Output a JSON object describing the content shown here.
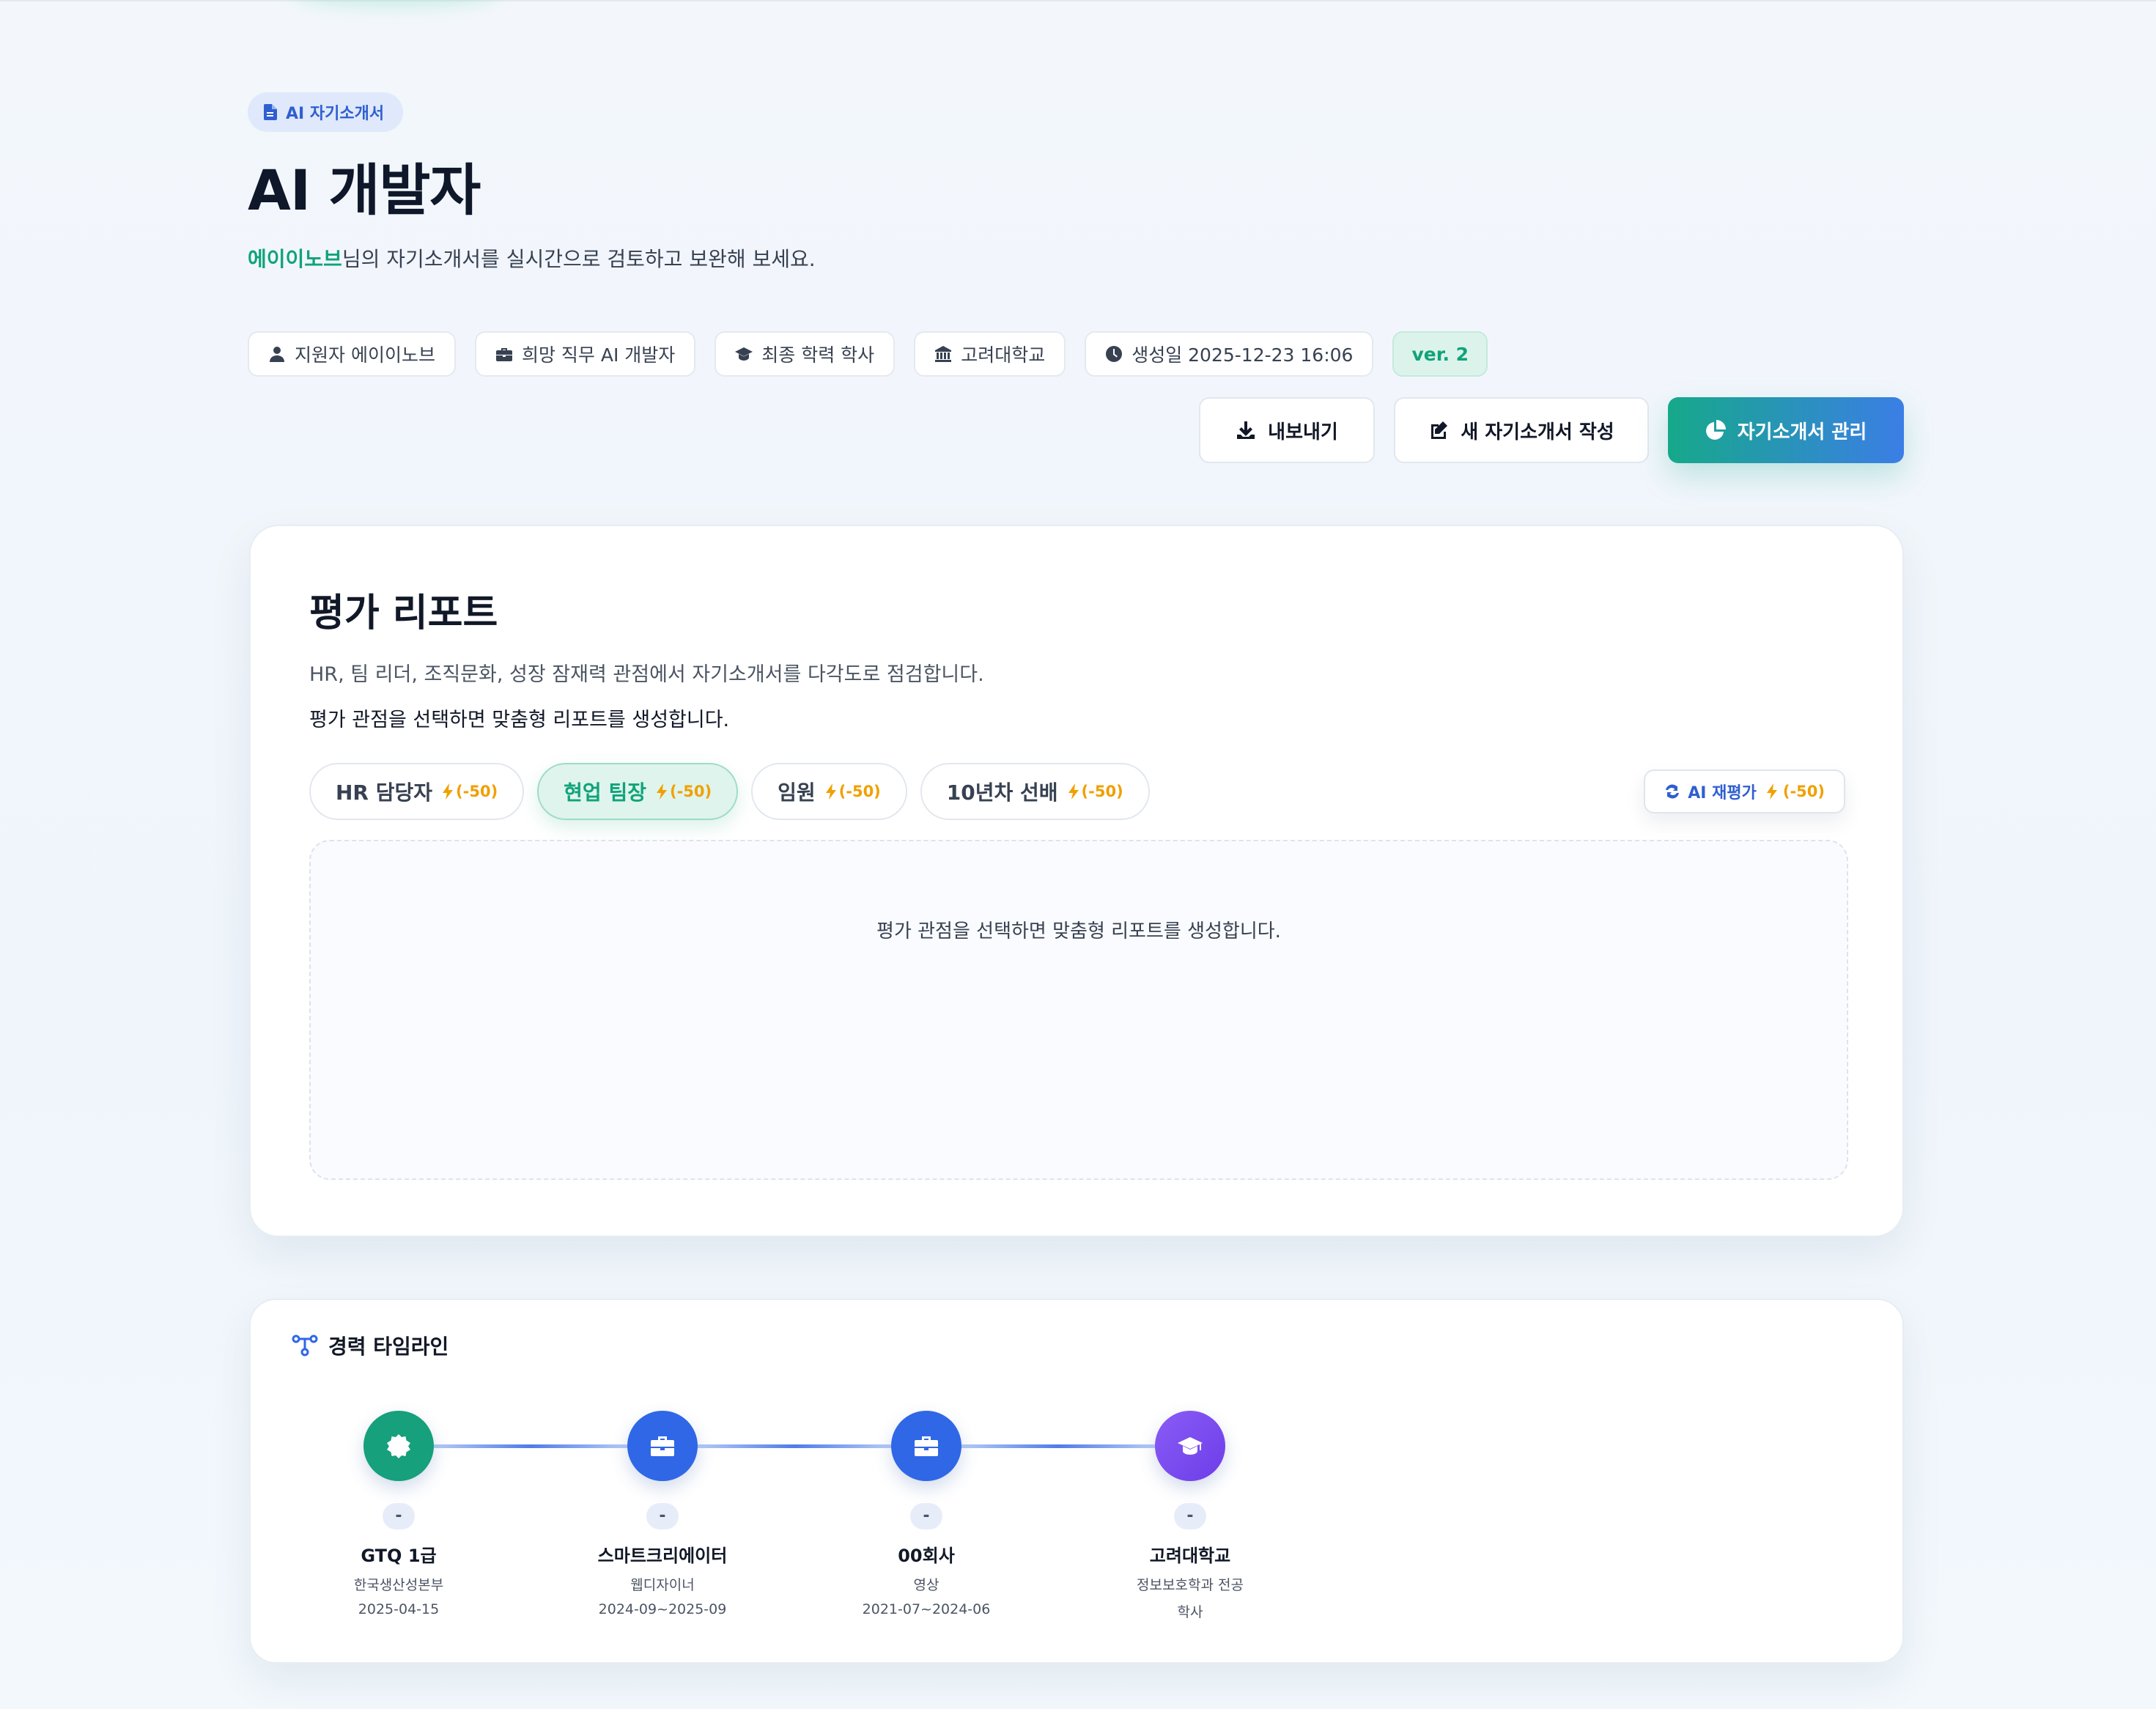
{
  "header": {
    "category_badge": "AI 자기소개서",
    "title": "AI 개발자",
    "subtitle_user": "에이이노브",
    "subtitle_rest": "님의 자기소개서를 실시간으로 검토하고 보완해 보세요.",
    "chips": {
      "applicant": "지원자 에이이노브",
      "job": "희망 직무 AI 개발자",
      "education": "최종 학력 학사",
      "school": "고려대학교",
      "created": "생성일 2025-12-23 16:06",
      "version": "ver. 2"
    },
    "actions": {
      "export": "내보내기",
      "new": "새 자기소개서 작성",
      "manage": "자기소개서 관리"
    }
  },
  "report": {
    "title": "평가 리포트",
    "description": "HR, 팀 리더, 조직문화, 성장 잠재력 관점에서 자기소개서를 다각도로 점검합니다.",
    "hint": "평가 관점을 선택하면 맞춤형 리포트를 생성합니다.",
    "tabs": [
      {
        "label": "HR 담당자",
        "cost": "(-50)"
      },
      {
        "label": "현업 팀장",
        "cost": "(-50)"
      },
      {
        "label": "임원",
        "cost": "(-50)"
      },
      {
        "label": "10년차 선배",
        "cost": "(-50)"
      }
    ],
    "active_tab": "현업 팀장",
    "reevaluate": {
      "label": "AI 재평가",
      "cost": "(-50)"
    },
    "placeholder": "평가 관점을 선택하면 맞춤형 리포트를 생성합니다."
  },
  "timeline": {
    "title": "경력 타임라인",
    "items": [
      {
        "icon": "certificate-icon",
        "date": "-",
        "name": "GTQ 1급",
        "sub": "한국생산성본부",
        "period": "2025-04-15"
      },
      {
        "icon": "briefcase-icon",
        "date": "-",
        "name": "스마트크리에이터",
        "sub": "웹디자이너",
        "period": "2024-09~2025-09"
      },
      {
        "icon": "briefcase-icon",
        "date": "-",
        "name": "00회사",
        "sub": "영상",
        "period": "2021-07~2024-06"
      },
      {
        "icon": "graduation-cap-icon",
        "date": "-",
        "name": "고려대학교",
        "sub": "정보보호학과 전공",
        "period": "학사"
      }
    ]
  },
  "colors": {
    "accent_green": "#10a37a",
    "accent_blue": "#2f67e6",
    "cost_orange": "#f0a000",
    "education_purple": "#7c4dee"
  }
}
